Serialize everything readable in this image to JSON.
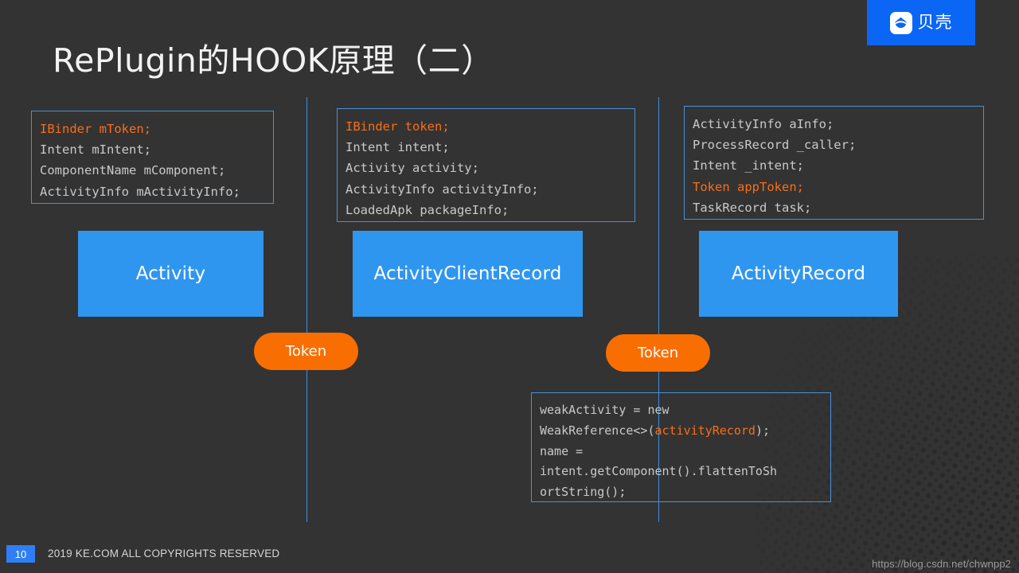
{
  "slide": {
    "title": "RePlugin的HOOK原理（二）",
    "background_color": "#333333",
    "accent_blue": "#2f96f0",
    "accent_orange": "#f96e00",
    "line_color": "#3b8fe0"
  },
  "logo": {
    "icon": "shell-house-icon",
    "text": "贝壳",
    "background_color": "#0b66f6"
  },
  "code_blocks": {
    "activity": {
      "highlight_line": "IBinder mToken;",
      "rest": "Intent mIntent;\nComponentName mComponent;\nActivityInfo mActivityInfo;"
    },
    "client_record": {
      "highlight_line": "IBinder token;",
      "rest": "Intent intent;\nActivity activity;\nActivityInfo activityInfo;\nLoadedApk packageInfo;"
    },
    "activity_record": {
      "before": "ActivityInfo aInfo;\nProcessRecord _caller;\nIntent _intent;\n",
      "highlight_line": "Token appToken;",
      "after": "\nTaskRecord task;"
    },
    "weak_activity": {
      "part1": "weakActivity = new\nWeakReference<>(",
      "highlight": "activityRecord",
      "part2": ");\nname =\nintent.getComponent().flattenToSh\nortString();"
    }
  },
  "class_boxes": [
    {
      "label": "Activity"
    },
    {
      "label": "ActivityClientRecord"
    },
    {
      "label": "ActivityRecord"
    }
  ],
  "token_pills": [
    {
      "label": "Token"
    },
    {
      "label": "Token"
    }
  ],
  "footer": {
    "page_number": "10",
    "copyright": "2019 KE.COM ALL COPYRIGHTS RESERVED",
    "watermark": "https://blog.csdn.net/chwnpp2"
  }
}
